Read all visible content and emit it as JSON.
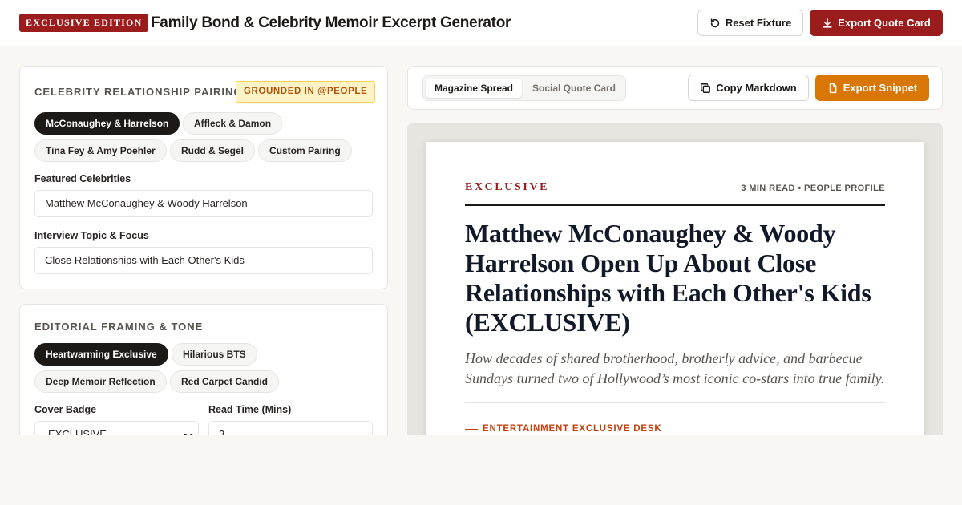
{
  "header": {
    "badge": "EXCLUSIVE EDITION",
    "title": "Family Bond & Celebrity Memoir Excerpt Generator",
    "reset_label": "Reset Fixture",
    "export_label": "Export Quote Card"
  },
  "pairing": {
    "section_title": "CELEBRITY RELATIONSHIP PAIRING",
    "grounded_badge": "GROUNDED IN @PEOPLE",
    "chips": [
      "McConaughey & Harrelson",
      "Affleck & Damon",
      "Tina Fey & Amy Poehler",
      "Rudd & Segel",
      "Custom Pairing"
    ],
    "active_chip": "McConaughey & Harrelson",
    "featured_label": "Featured Celebrities",
    "featured_value": "Matthew McConaughey & Woody Harrelson",
    "topic_label": "Interview Topic & Focus",
    "topic_value": "Close Relationships with Each Other's Kids"
  },
  "tone": {
    "section_title": "EDITORIAL FRAMING & TONE",
    "chips": [
      "Heartwarming Exclusive",
      "Hilarious BTS",
      "Deep Memoir Reflection",
      "Red Carpet Candid"
    ],
    "active_chip": "Heartwarming Exclusive",
    "badge_label": "Cover Badge",
    "badge_value": "EXCLUSIVE",
    "readtime_label": "Read Time (Mins)",
    "readtime_value": "3"
  },
  "preview_toolbar": {
    "tabs": [
      "Magazine Spread",
      "Social Quote Card"
    ],
    "active_tab": "Magazine Spread",
    "copy_label": "Copy Markdown",
    "snippet_label": "Export Snippet"
  },
  "article": {
    "kicker": "EXCLUSIVE",
    "meta": "3 MIN READ • PEOPLE PROFILE",
    "headline": "Matthew McConaughey & Woody Harrelson Open Up About Close Relationships with Each Other's Kids (EXCLUSIVE)",
    "dek": "How decades of shared brotherhood, brotherly advice, and barbecue Sundays turned two of Hollywood’s most iconic co-stars into true family.",
    "desk": "ENTERTAINMENT EXCLUSIVE DESK"
  },
  "colors": {
    "brand_red": "#9b1c1c",
    "accent_orange": "#d97706",
    "ink": "#1c1917"
  }
}
